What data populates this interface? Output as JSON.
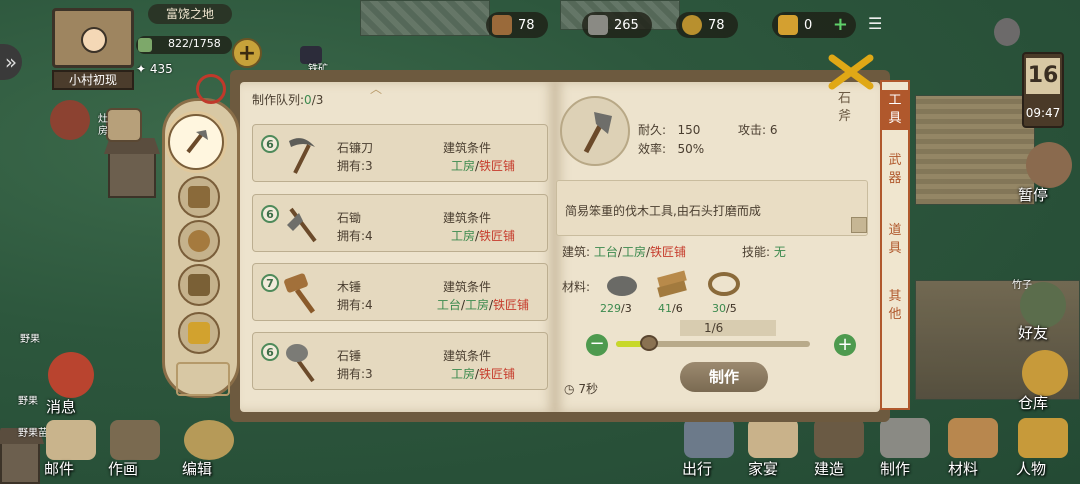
{
  "village": {
    "region": "富饶之地",
    "name": "小村初现",
    "exp": "822/1758",
    "population": "435",
    "marker_label": "铁矿",
    "stove_label": "灶房"
  },
  "resources": [
    {
      "name": "wood",
      "value": "78"
    },
    {
      "name": "stone",
      "value": "265"
    },
    {
      "name": "coin",
      "value": "78"
    },
    {
      "name": "ticket",
      "value": "0"
    }
  ],
  "clock": {
    "day": "16",
    "time": "09:47"
  },
  "queue": {
    "label": "制作队列:",
    "current": "0",
    "sep": "/",
    "max": "3"
  },
  "recipes": [
    {
      "level": "6",
      "name": "石镰刀",
      "owned": "拥有:3",
      "cond": "建筑条件",
      "b1": "工房",
      "b2": "铁匠铺",
      "b0": ""
    },
    {
      "level": "6",
      "name": "石锄",
      "owned": "拥有:4",
      "cond": "建筑条件",
      "b1": "工房",
      "b2": "铁匠铺",
      "b0": ""
    },
    {
      "level": "7",
      "name": "木锤",
      "owned": "拥有:4",
      "cond": "建筑条件",
      "b0": "工台",
      "b1": "工房",
      "b2": "铁匠铺"
    },
    {
      "level": "6",
      "name": "石锤",
      "owned": "拥有:3",
      "cond": "建筑条件",
      "b1": "工房",
      "b2": "铁匠铺",
      "b0": ""
    }
  ],
  "detail": {
    "name": "石斧",
    "durability_label": "耐久:",
    "durability": "150",
    "attack_label": "攻击:",
    "attack": "6",
    "efficiency_label": "效率:",
    "efficiency": "50%",
    "description": "简易笨重的伐木工具,由石头打磨而成",
    "building_label": "建筑:",
    "b0": "工台",
    "b1": "工房",
    "b2": "铁匠铺",
    "skill_label": "技能:",
    "skill": "无",
    "materials_label": "材料:",
    "materials": [
      {
        "name": "stone",
        "have": "229",
        "need": "/3"
      },
      {
        "name": "plank",
        "have": "41",
        "need": "/6"
      },
      {
        "name": "rope",
        "have": "30",
        "need": "/5"
      }
    ],
    "quantity": "1/6",
    "quantity_fraction": 0.17,
    "craft_label": "制作",
    "duration": "7秒"
  },
  "category_tabs": [
    "工具",
    "武器",
    "道具",
    "其他"
  ],
  "left_menu": {
    "message": "消息",
    "mail": "邮件",
    "painting": "作画",
    "edit": "编辑",
    "wild1": "野果",
    "wild2": "野果",
    "wild3": "野果苗"
  },
  "right_menu": {
    "pause": "暂停",
    "friends": "好友",
    "warehouse": "仓库",
    "bamboo": "竹子"
  },
  "bottom_menu": [
    "出行",
    "家宴",
    "建造",
    "制作",
    "材料",
    "人物"
  ],
  "colors": {
    "green": "#3b8a4e",
    "red": "#c63c2c",
    "tab_accent": "#b0582c"
  }
}
